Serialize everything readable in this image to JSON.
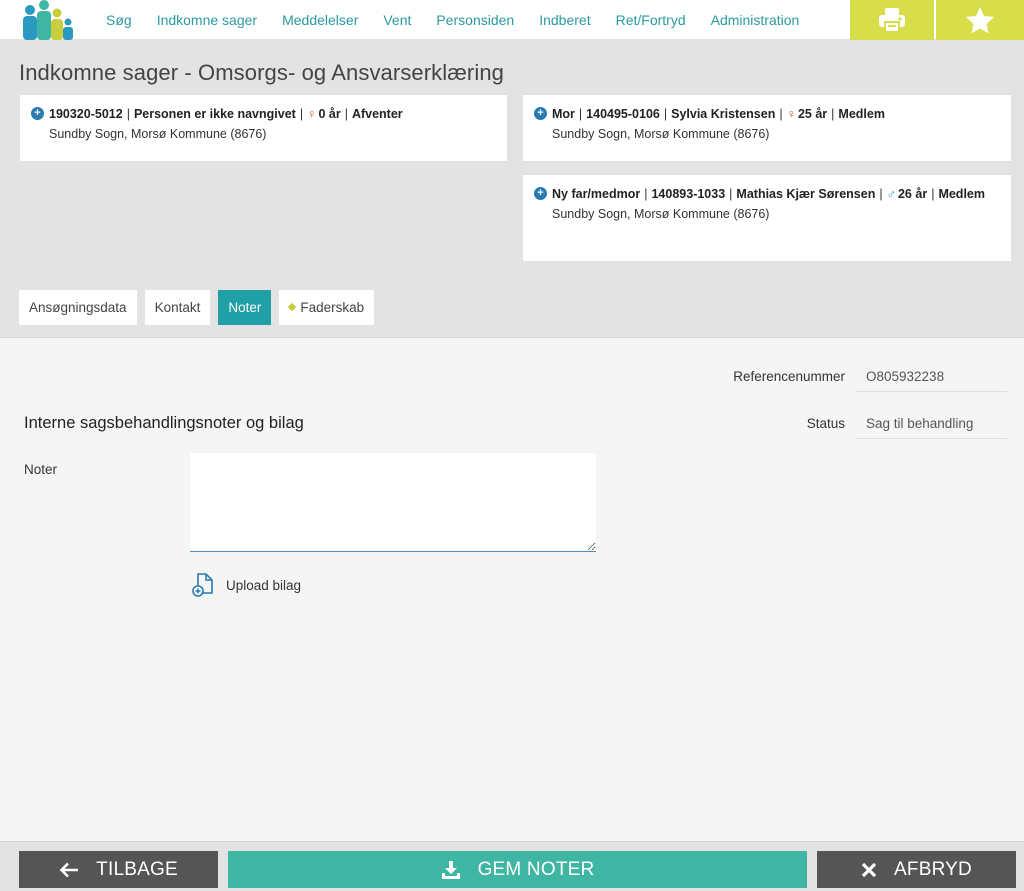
{
  "nav": {
    "items": [
      "Søg",
      "Indkomne sager",
      "Meddelelser",
      "Vent",
      "Personsiden",
      "Indberet",
      "Ret/Fortryd",
      "Administration"
    ]
  },
  "page": {
    "title": "Indkomne sager - Omsorgs- og Ansvarserklæring"
  },
  "persons": [
    {
      "parts": [
        "190320-5012",
        "Personen er ikke navngivet",
        "0 år",
        "Afventer"
      ],
      "gender": "female",
      "address": "Sundby Sogn, Morsø Kommune (8676)"
    },
    {
      "parts": [
        "Mor",
        "140495-0106",
        "Sylvia Kristensen",
        "25 år",
        "Medlem"
      ],
      "gender": "female",
      "address": "Sundby Sogn, Morsø Kommune (8676)"
    },
    {
      "parts": [
        "Ny far/medmor",
        "140893-1033",
        "Mathias Kjær Sørensen",
        "26 år",
        "Medlem"
      ],
      "gender": "male",
      "address": "Sundby Sogn, Morsø Kommune (8676)"
    }
  ],
  "tabs": [
    "Ansøgningsdata",
    "Kontakt",
    "Noter",
    "Faderskab"
  ],
  "active_tab": "Noter",
  "main": {
    "reference_label": "Referencenummer",
    "reference_value": "O805932238",
    "status_label": "Status",
    "status_value": "Sag til behandling",
    "section_title": "Interne sagsbehandlingsnoter og bilag",
    "notes_label": "Noter",
    "notes_value": "",
    "upload_label": "Upload bilag"
  },
  "footer": {
    "back_label": "TILBAGE",
    "save_label": "GEM NOTER",
    "cancel_label": "AFBRYD"
  },
  "colors": {
    "accent": "#1f9fa6",
    "nav_link": "#2a9aa0",
    "nav_button": "#d8de4a",
    "save_button": "#3fb6a3",
    "dark_button": "#555555"
  }
}
